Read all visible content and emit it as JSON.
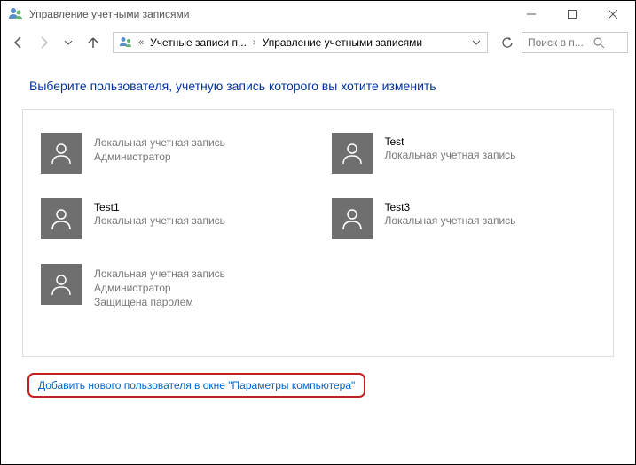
{
  "window": {
    "title": "Управление учетными записями"
  },
  "breadcrumb": {
    "seg1": "Учетные записи п...",
    "seg2": "Управление учетными записями"
  },
  "search": {
    "placeholder": "Поиск в п..."
  },
  "heading": "Выберите пользователя, учетную запись которого вы хотите изменить",
  "users": [
    {
      "name": "",
      "line1": "Локальная учетная запись",
      "line2": "Администратор",
      "line3": ""
    },
    {
      "name": "Test",
      "line1": "Локальная учетная запись",
      "line2": "",
      "line3": ""
    },
    {
      "name": "Test1",
      "line1": "Локальная учетная запись",
      "line2": "",
      "line3": ""
    },
    {
      "name": "Test3",
      "line1": "Локальная учетная запись",
      "line2": "",
      "line3": ""
    },
    {
      "name": "",
      "line1": "Локальная учетная запись",
      "line2": "Администратор",
      "line3": "Защищена паролем"
    }
  ],
  "footer": {
    "add_user_link": "Добавить нового пользователя в окне \"Параметры компьютера\""
  }
}
